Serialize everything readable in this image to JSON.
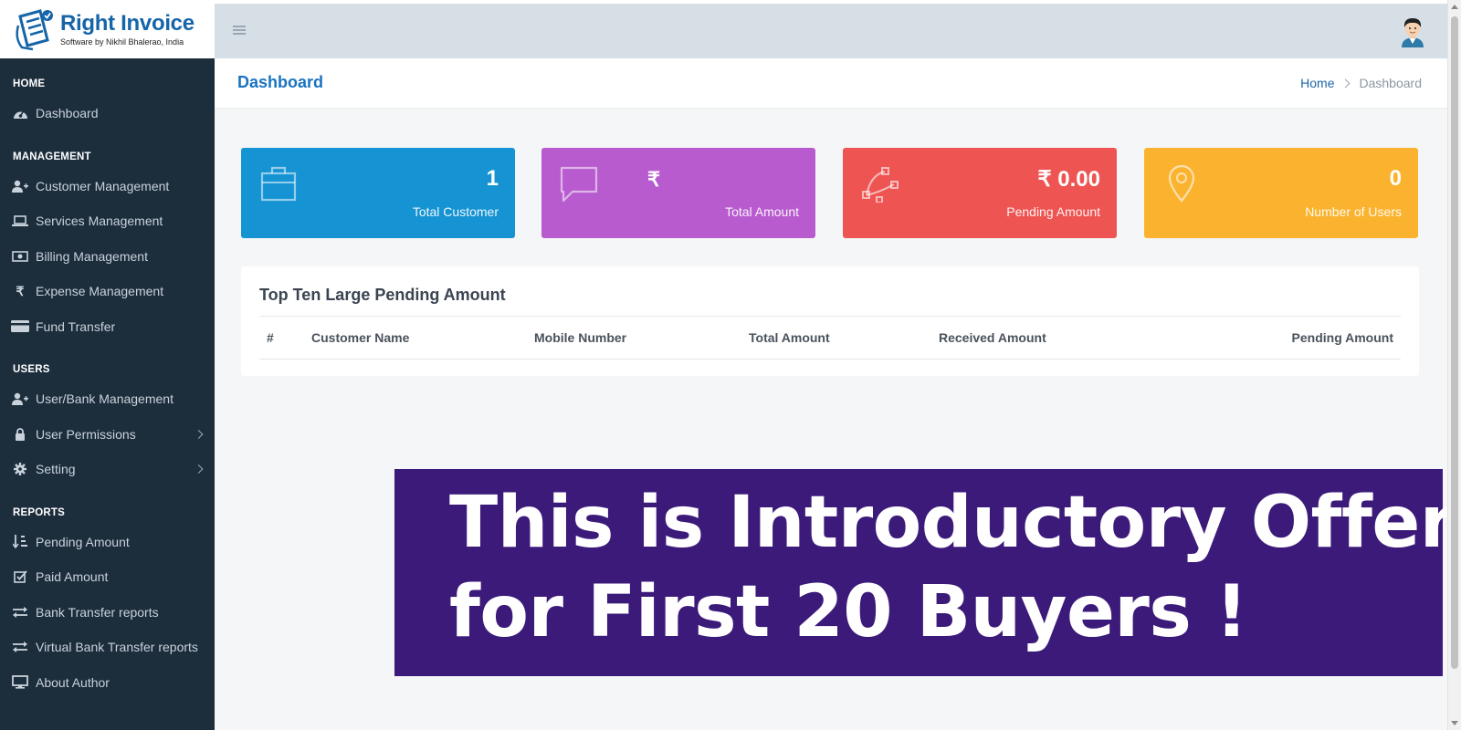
{
  "brand": {
    "title": "Right Invoice",
    "subtitle": "Software by Nikhil Bhalerao, India"
  },
  "sidebar": {
    "sections": [
      {
        "label": "HOME"
      },
      {
        "label": "MANAGEMENT"
      },
      {
        "label": "USERS"
      },
      {
        "label": "REPORTS"
      }
    ],
    "items": [
      {
        "label": "Dashboard",
        "icon": "dashboard-icon"
      },
      {
        "label": "Customer Management",
        "icon": "user-add-icon"
      },
      {
        "label": "Services Management",
        "icon": "laptop-icon"
      },
      {
        "label": "Billing Management",
        "icon": "money-icon"
      },
      {
        "label": "Expense Management",
        "icon": "rupee-icon"
      },
      {
        "label": "Fund Transfer",
        "icon": "card-icon"
      },
      {
        "label": "User/Bank Management",
        "icon": "user-add-icon"
      },
      {
        "label": "User Permissions",
        "icon": "lock-icon"
      },
      {
        "label": "Setting",
        "icon": "gear-icon"
      },
      {
        "label": "Pending Amount",
        "icon": "sort-numeric-icon"
      },
      {
        "label": "Paid Amount",
        "icon": "checkbox-icon"
      },
      {
        "label": "Bank Transfer reports",
        "icon": "exchange-icon"
      },
      {
        "label": "Virtual Bank Transfer reports",
        "icon": "exchange-icon"
      },
      {
        "label": "About Author",
        "icon": "monitor-icon"
      }
    ]
  },
  "header": {
    "page_title": "Dashboard",
    "breadcrumb": {
      "home": "Home",
      "current": "Dashboard"
    }
  },
  "cards": [
    {
      "value": "1",
      "label": "Total Customer",
      "color": "#1693d3",
      "icon": "briefcase-icon"
    },
    {
      "value": "₹",
      "label": "Total Amount",
      "color": "#b85bcf",
      "icon": "comment-icon"
    },
    {
      "value": "₹ 0.00",
      "label": "Pending Amount",
      "color": "#ee5452",
      "icon": "vector-icon"
    },
    {
      "value": "0",
      "label": "Number of Users",
      "color": "#fbb32f",
      "icon": "map-pin-icon"
    }
  ],
  "table": {
    "title": "Top Ten Large Pending Amount",
    "columns": [
      "#",
      "Customer Name",
      "Mobile Number",
      "Total Amount",
      "Received Amount",
      "Pending Amount"
    ]
  },
  "promo": {
    "line1": "This is Introductory Offer",
    "line2": "for First 20 Buyers !",
    "color": "#3c1a7a"
  }
}
